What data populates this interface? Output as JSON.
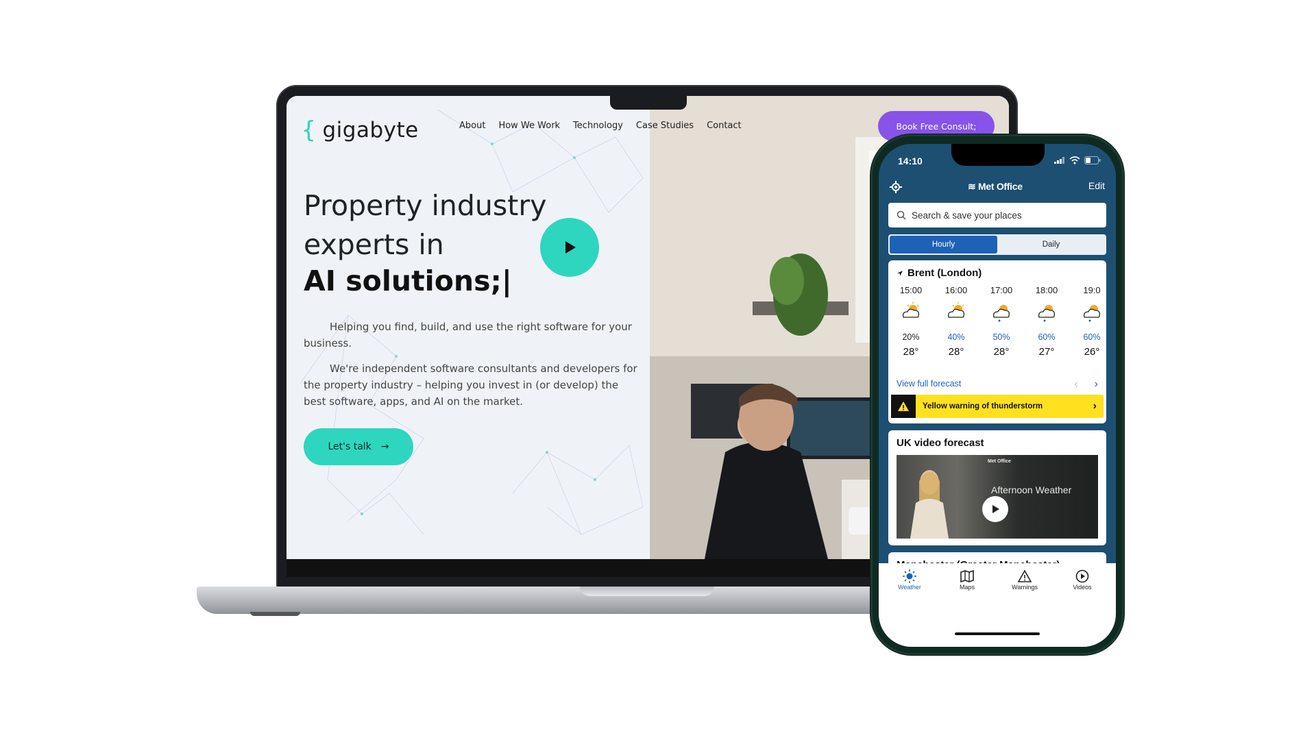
{
  "laptop_site": {
    "brand": {
      "mark": "{",
      "name": "gigabyte"
    },
    "nav": [
      "About",
      "How We Work",
      "Technology",
      "Case Studies",
      "Contact"
    ],
    "cta_consult": "Book Free Consult;",
    "hero_line1": "Property industry",
    "hero_line2": "experts in",
    "hero_line3": "AI solutions;|",
    "para1": "Helping you find, build, and use the right software for your business.",
    "para2": "We're independent software consultants and developers for the property industry – helping you invest in (or develop) the best software, apps, and AI on the market.",
    "talk_button": "Let's talk",
    "talk_arrow": "→",
    "accent": "#2ed6bf",
    "purple": "#8753e8"
  },
  "phone_app": {
    "status_time": "14:10",
    "app_title": "Met Office",
    "edit": "Edit",
    "search_placeholder": "Search & save your places",
    "segments": [
      "Hourly",
      "Daily"
    ],
    "location": "Brent (London)",
    "hourly": [
      {
        "time": "15:00",
        "prob": "20%",
        "temp": "28°"
      },
      {
        "time": "16:00",
        "prob": "40%",
        "temp": "28°"
      },
      {
        "time": "17:00",
        "prob": "50%",
        "temp": "28°"
      },
      {
        "time": "18:00",
        "prob": "60%",
        "temp": "27°"
      },
      {
        "time": "19:0",
        "prob": "60%",
        "temp": "26°"
      }
    ],
    "view_full": "View full forecast",
    "warning": "Yellow warning of thunderstorm",
    "video_title": "UK video forecast",
    "video_brand": "Met Office",
    "video_text": "Afternoon Weather",
    "next_location": "Manchester (Greater Manchester)",
    "tabs": [
      "Weather",
      "Maps",
      "Warnings",
      "Videos"
    ],
    "link_color": "#1e62b6",
    "warning_color": "#ffe11f"
  }
}
